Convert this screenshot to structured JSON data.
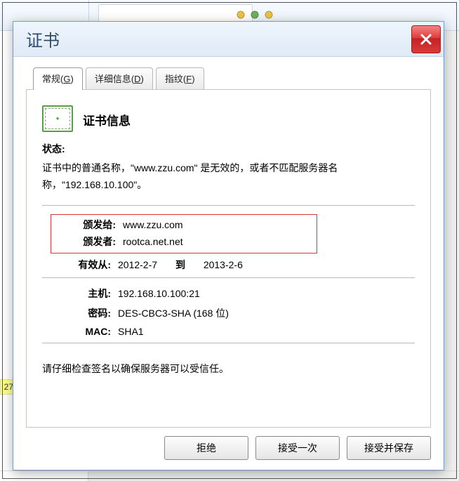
{
  "bg": {
    "yellow_text": "27."
  },
  "dialog": {
    "title": "证书",
    "tabs": [
      {
        "label_pre": "常规(",
        "label_key": "G",
        "label_post": ")"
      },
      {
        "label_pre": "详细信息(",
        "label_key": "D",
        "label_post": ")"
      },
      {
        "label_pre": "指纹(",
        "label_key": "F",
        "label_post": ")"
      }
    ],
    "cert_info_heading": "证书信息",
    "status_label": "状态:",
    "status_text": "证书中的普通名称，\"www.zzu.com\" 是无效的，或者不匹配服务器名称，\"192.168.10.100\"。",
    "fields": {
      "issued_to_label": "颁发给:",
      "issued_to_val": "www.zzu.com",
      "issuer_label": "颁发者:",
      "issuer_val": "rootca.net.net",
      "valid_from_label": "有效从:",
      "valid_from_val": "2012-2-7",
      "valid_to_label": "到",
      "valid_to_val": "2013-2-6",
      "host_label": "主机:",
      "host_val": "192.168.10.100:21",
      "cipher_label": "密码:",
      "cipher_val": "DES-CBC3-SHA (168 位)",
      "mac_label": "MAC:",
      "mac_val": "SHA1"
    },
    "footnote": "请仔细检查签名以确保服务器可以受信任。",
    "buttons": {
      "reject": "拒绝",
      "accept_once": "接受一次",
      "accept_save": "接受并保存"
    }
  }
}
